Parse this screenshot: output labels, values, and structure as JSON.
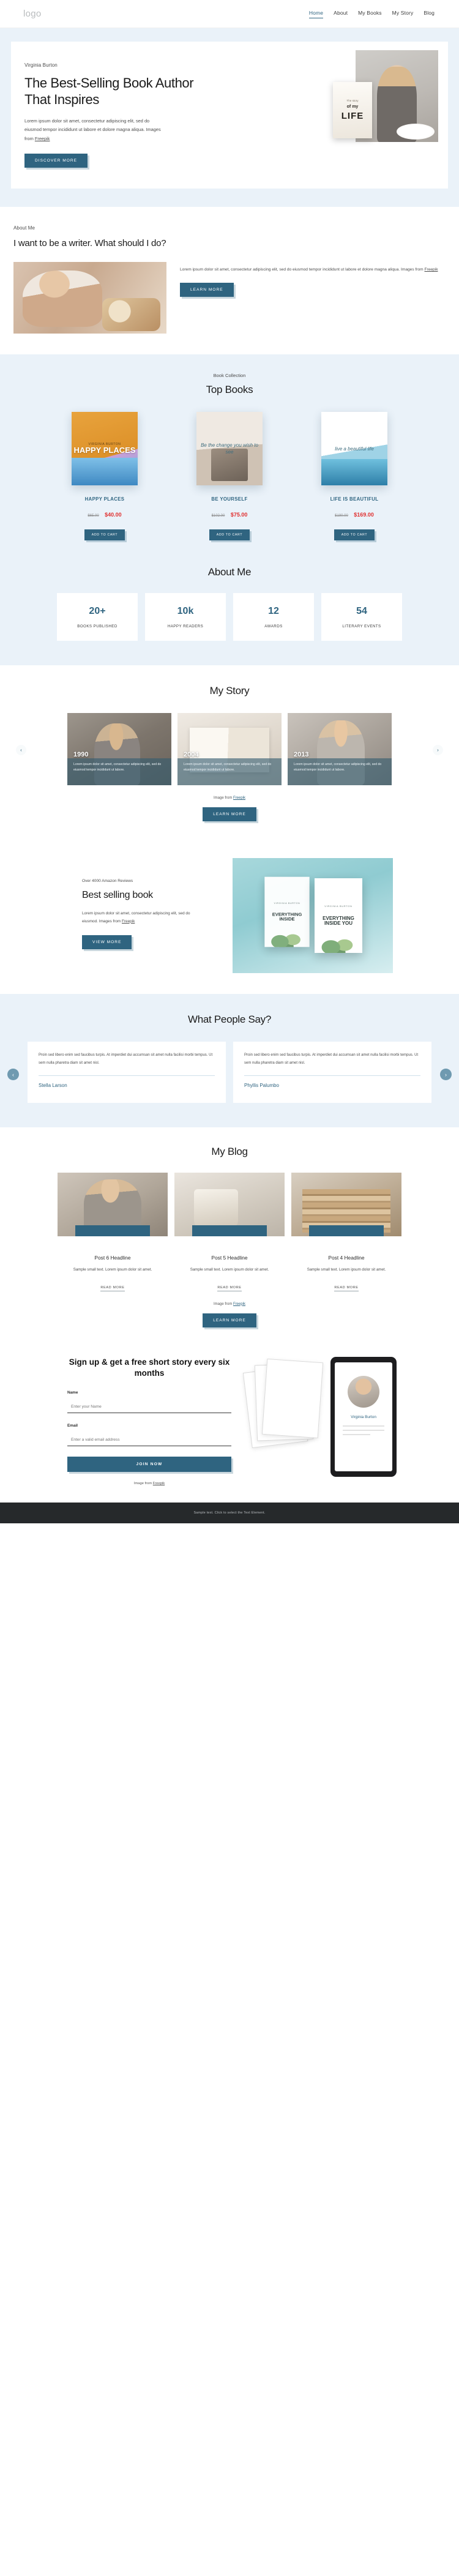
{
  "header": {
    "logo": "logo",
    "nav": [
      {
        "label": "Home",
        "active": true
      },
      {
        "label": "About",
        "active": false
      },
      {
        "label": "My Books",
        "active": false
      },
      {
        "label": "My Story",
        "active": false
      },
      {
        "label": "Blog",
        "active": false
      }
    ]
  },
  "hero": {
    "eyebrow": "Virginia Burton",
    "title": "The Best-Selling Book Author That Inspires",
    "copy": "Lorem ipsum dolor sit amet, consectetur adipiscing elit, sed do eiusmod tempor incididunt ut labore et dolore magna aliqua. Images from ",
    "credit_link": "Freepik",
    "cta": "DISCOVER MORE",
    "book_sub": "The story",
    "book_of": "of my",
    "book_title": "LIFE"
  },
  "about": {
    "eyebrow": "About Me",
    "title": "I want to be a writer. What should I do?",
    "copy": "Lorem ipsum dolor sit amet, consectetur adipiscing elit, sed do eiusmod tempor incididunt ut labore et dolore magna aliqua. Images from ",
    "credit_link": "Freepik",
    "cta": "LEARN MORE"
  },
  "books": {
    "eyebrow": "Book Collection",
    "title": "Top Books",
    "items": [
      {
        "name": "HAPPY PLACES",
        "price_old": "$65.00",
        "price_new": "$40.00",
        "cta": "ADD TO CART",
        "cover_label": "VIRGINIA BURTON",
        "cover_title": "HAPPY PLACES"
      },
      {
        "name": "BE YOURSELF",
        "price_old": "$102.00",
        "price_new": "$75.00",
        "cta": "ADD TO CART",
        "cover_label": "",
        "cover_title": "Be the change you wish to see"
      },
      {
        "name": "LIFE IS BEAUTIFUL",
        "price_old": "$190.00",
        "price_new": "$169.00",
        "cta": "ADD TO CART",
        "cover_label": "",
        "cover_title": "live a beautiful life"
      }
    ]
  },
  "stats": {
    "title": "About Me",
    "items": [
      {
        "value": "20+",
        "label": "BOOKS PUBLISHED"
      },
      {
        "value": "10k",
        "label": "HAPPY READERS"
      },
      {
        "value": "12",
        "label": "AWARDS"
      },
      {
        "value": "54",
        "label": "LITERARY EVENTS"
      }
    ]
  },
  "story": {
    "title": "My Story",
    "items": [
      {
        "year": "1990",
        "caption": "Lorem ipsum dolor sit amet, consectetur adipiscing elit, sed do eiusmod tempor incididunt ut labore."
      },
      {
        "year": "2004",
        "caption": "Lorem ipsum dolor sit amet, consectetur adipiscing elit, sed do eiusmod tempor incididunt ut labore."
      },
      {
        "year": "2013",
        "caption": "Lorem ipsum dolor sit amet, consectetur adipiscing elit, sed do eiusmod tempor incididunt ut labore."
      }
    ],
    "prev_icon": "‹",
    "next_icon": "›",
    "credit_prefix": "Image from ",
    "credit_link": "Freepik",
    "cta": "LEARN MORE"
  },
  "best": {
    "eyebrow": "Over 4000 Amazon Reviews",
    "title": "Best selling book",
    "copy": "Lorem ipsum dolor sit amet, consectetur adipiscing elit, sed do eiusmod. Images from ",
    "credit_link": "Freepik",
    "cta": "VIEW MORE",
    "cover_brand": "VIRGINIA BURTON",
    "cover_title": "EVERYTHING INSIDE YOU",
    "cover_title_back": "EVERYTHING INSIDE"
  },
  "testimonials": {
    "title": "What People Say?",
    "prev_icon": "‹",
    "next_icon": "›",
    "items": [
      {
        "quote": "Proin sed libero enim sed faucibus turpis. At imperdiet dui accumsan sit amet nulla facilisi morbi tempus. Ut sem nulla pharetra diam sit amet nisl.",
        "name": "Stella Larson"
      },
      {
        "quote": "Proin sed libero enim sed faucibus turpis. At imperdiet dui accumsan sit amet nulla facilisi morbi tempus. Ut sem nulla pharetra diam sit amet nisl.",
        "name": "Phyllis Palumbo"
      }
    ]
  },
  "blog": {
    "title": "My Blog",
    "posts": [
      {
        "headline": "Post 6 Headline",
        "excerpt": "Sample small text. Lorem ipsum dolor sit amet.",
        "link": "READ MORE"
      },
      {
        "headline": "Post 5 Headline",
        "excerpt": "Sample small text. Lorem ipsum dolor sit amet.",
        "link": "READ MORE"
      },
      {
        "headline": "Post 4 Headline",
        "excerpt": "Sample small text. Lorem ipsum dolor sit amet.",
        "link": "READ MORE"
      }
    ],
    "credit_prefix": "Image from ",
    "credit_link": "Freepik",
    "cta": "LEARN MORE"
  },
  "newsletter": {
    "title": "Sign up & get a free short story every six months",
    "name_label": "Name",
    "name_placeholder": "Enter your Name",
    "email_label": "Email",
    "email_placeholder": "Enter a valid email address",
    "cta": "JOIN NOW",
    "credit_prefix": "Image from ",
    "credit_link": "Freepik",
    "tablet_name": "Virginia Burton"
  },
  "footer": {
    "text": "Sample text. Click to select the Text Element."
  },
  "colors": {
    "accent": "#2f6480",
    "band": "#eaf2f9",
    "sale": "#e03131",
    "footer_bg": "#26292b"
  }
}
